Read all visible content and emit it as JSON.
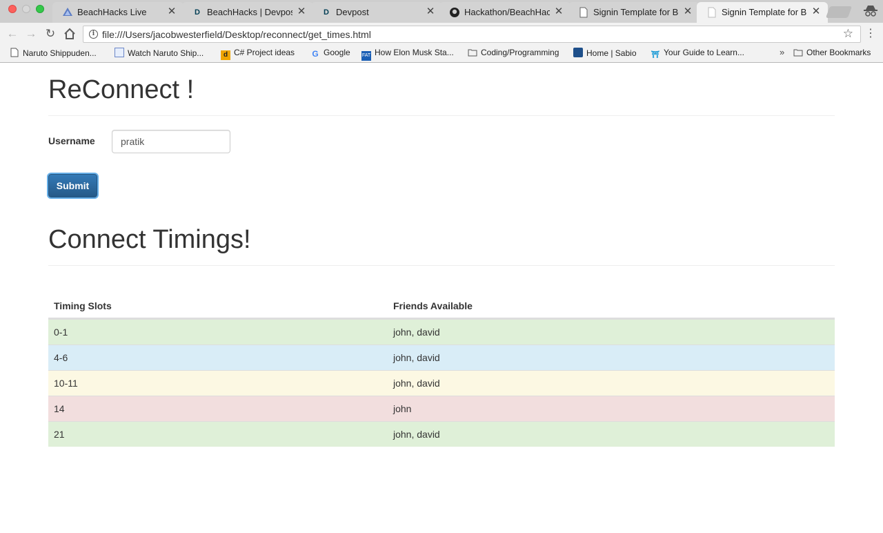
{
  "browser": {
    "tabs": [
      {
        "title": "BeachHacks Live",
        "icon": "beachhacks-icon",
        "active": false
      },
      {
        "title": "BeachHacks | Devpost",
        "icon": "devpost-icon",
        "active": false
      },
      {
        "title": "Devpost",
        "icon": "devpost-icon",
        "active": false
      },
      {
        "title": "Hackathon/BeachHacks",
        "icon": "github-icon",
        "active": false
      },
      {
        "title": "Signin Template for Boo",
        "icon": "document-icon",
        "active": false
      },
      {
        "title": "Signin Template for Boo",
        "icon": "document-icon",
        "active": true
      }
    ],
    "url": "file:///Users/jacobwesterfield/Desktop/reconnect/get_times.html",
    "bookmarks": [
      {
        "label": "Naruto Shippuden...",
        "icon": "document-icon"
      },
      {
        "label": "Watch Naruto Ship...",
        "icon": "bookmark-site-icon"
      },
      {
        "label": "C# Project ideas",
        "icon": "d-icon"
      },
      {
        "label": "Google",
        "icon": "google-icon"
      },
      {
        "label": "How Elon Musk Sta...",
        "icon": "site-icon"
      },
      {
        "label": "Coding/Programming",
        "icon": "folder-icon"
      },
      {
        "label": "Home | Sabio",
        "icon": "sabio-icon"
      },
      {
        "label": "Your Guide to Learn...",
        "icon": "torii-icon"
      }
    ],
    "other_bookmarks": "Other Bookmarks"
  },
  "page": {
    "title": "ReConnect !",
    "username_label": "Username",
    "username_value": "pratik",
    "submit_label": "Submit",
    "timings_title": "Connect Timings!",
    "table": {
      "headers": [
        "Timing Slots",
        "Friends Available"
      ],
      "rows": [
        {
          "slot": "0-1",
          "friends": "john, david",
          "color": "#dff0d8"
        },
        {
          "slot": "4-6",
          "friends": "john, david",
          "color": "#d9edf7"
        },
        {
          "slot": "10-11",
          "friends": "john, david",
          "color": "#fcf8e3"
        },
        {
          "slot": "14",
          "friends": "john",
          "color": "#f2dede"
        },
        {
          "slot": "21",
          "friends": "john, david",
          "color": "#dff0d8"
        }
      ]
    }
  }
}
